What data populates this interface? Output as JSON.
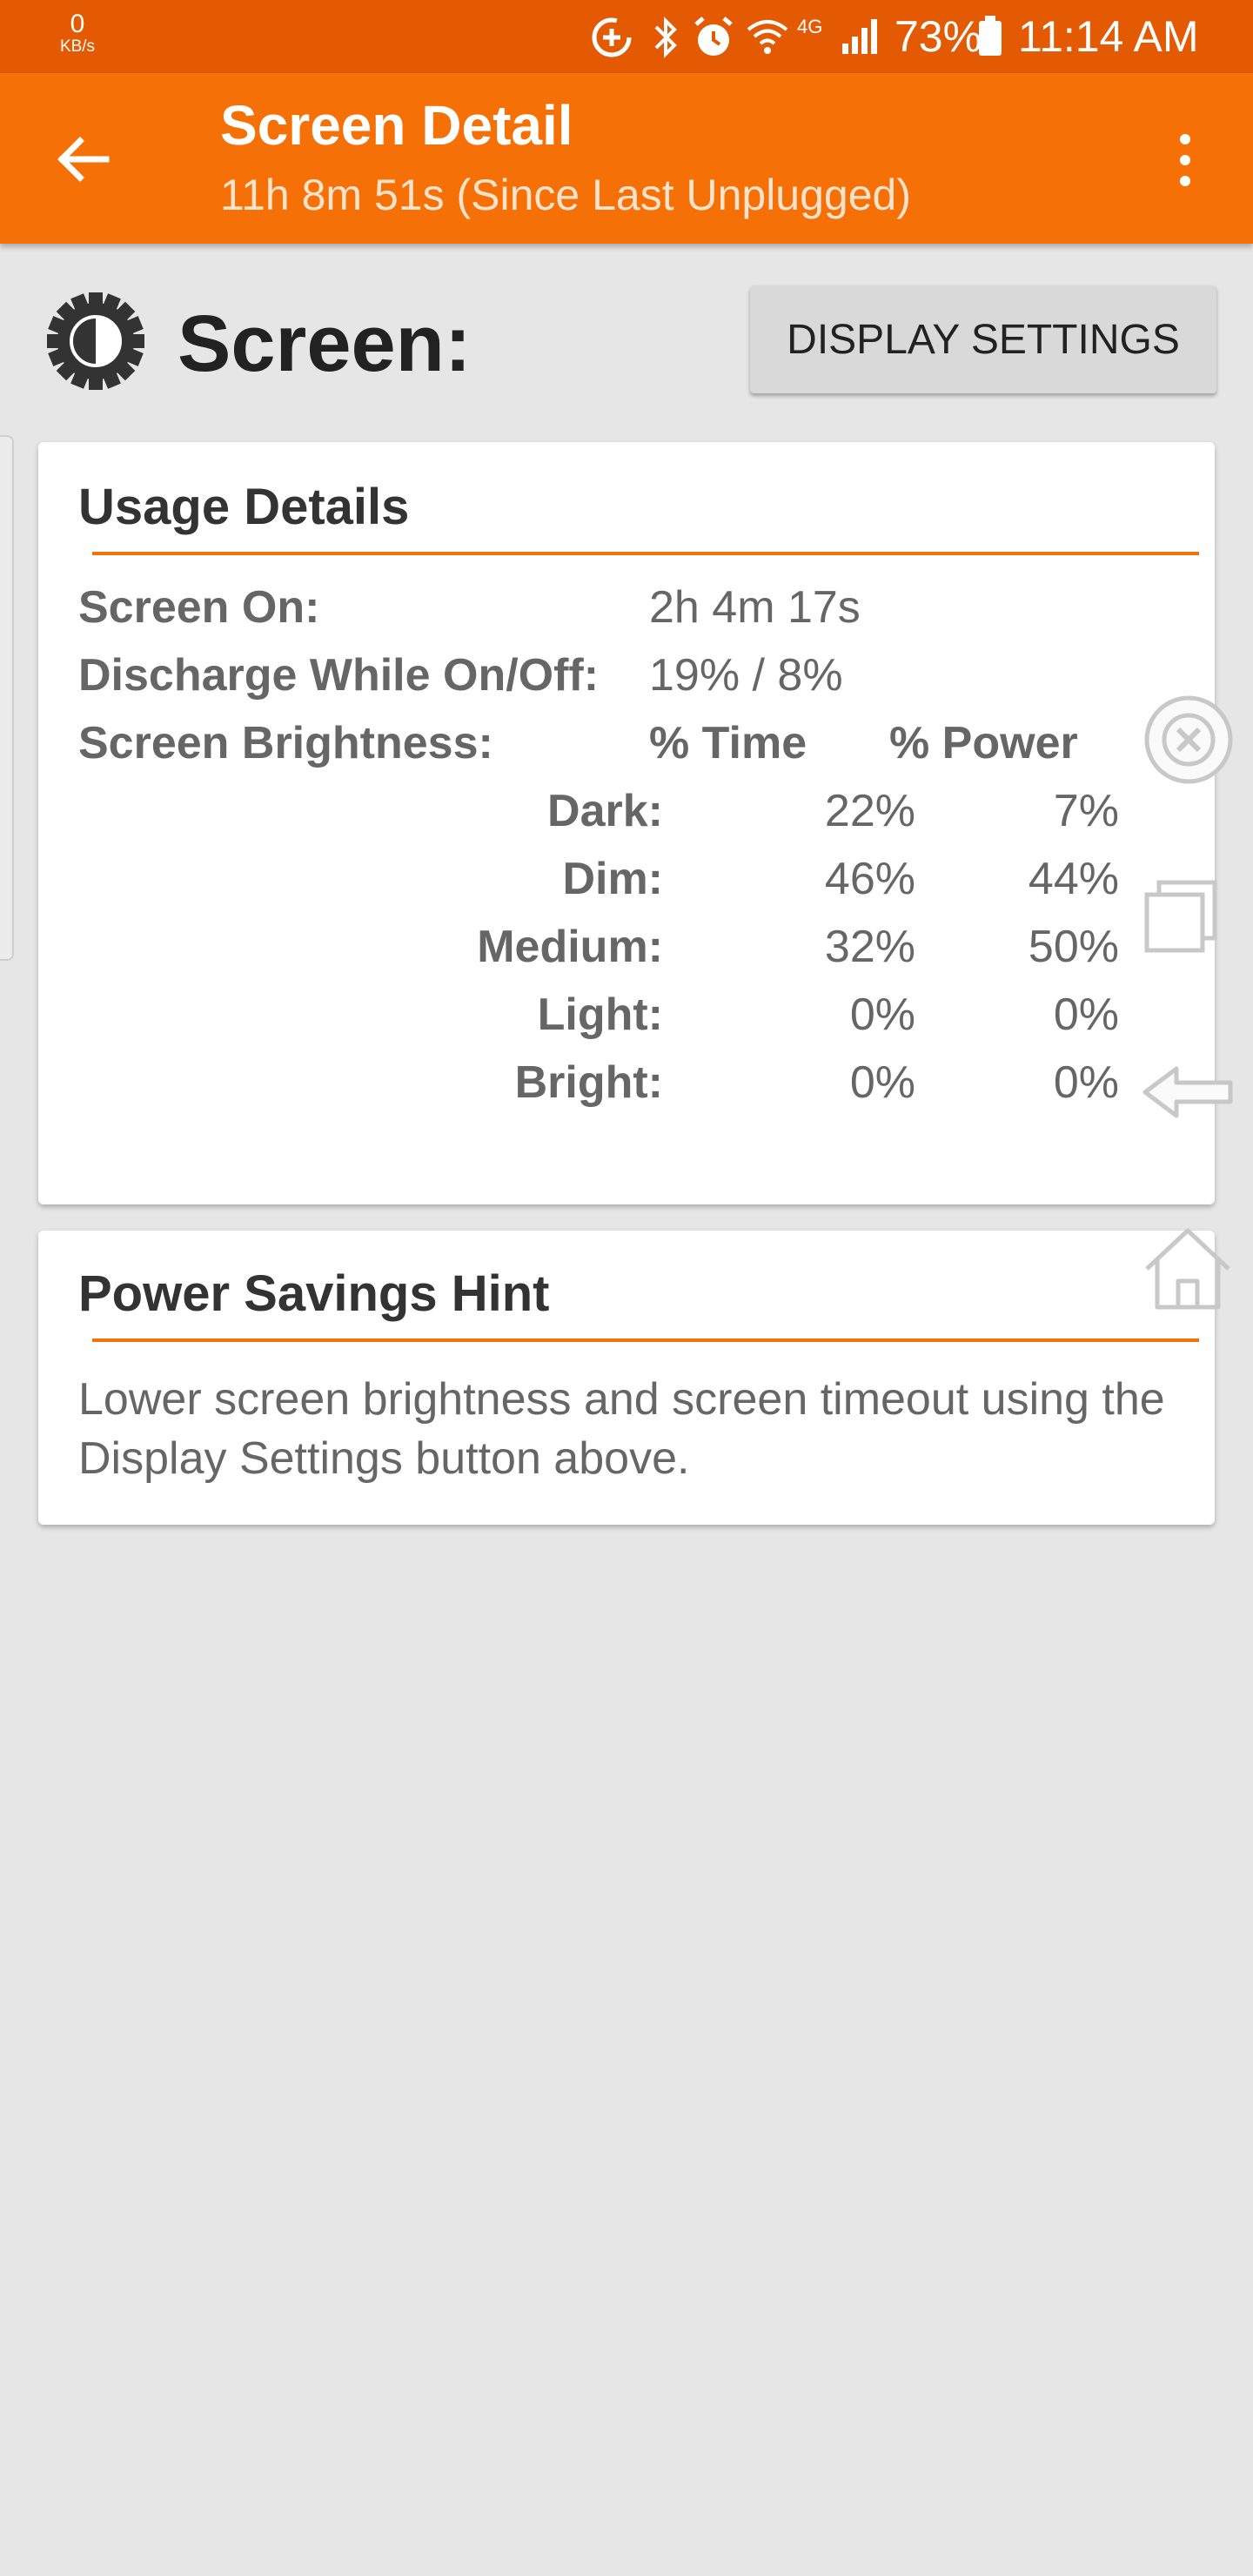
{
  "status_bar": {
    "net_speed_value": "0",
    "net_speed_unit": "KB/s",
    "network_type": "4G",
    "battery_percent": "73%",
    "time": "11:14 AM"
  },
  "app_bar": {
    "title": "Screen Detail",
    "subtitle": "11h 8m 51s (Since Last Unplugged)"
  },
  "header": {
    "heading": "Screen:",
    "display_settings_label": "DISPLAY SETTINGS"
  },
  "usage_details": {
    "title": "Usage Details",
    "screen_on_label": "Screen On:",
    "screen_on_value": "2h 4m 17s",
    "discharge_label": "Discharge While On/Off:",
    "discharge_value": "19% / 8%",
    "brightness_label": "Screen Brightness:",
    "col_time": "% Time",
    "col_power": "% Power",
    "rows": [
      {
        "label": "Dark:",
        "time": "22%",
        "power": "7%"
      },
      {
        "label": "Dim:",
        "time": "46%",
        "power": "44%"
      },
      {
        "label": "Medium:",
        "time": "32%",
        "power": "50%"
      },
      {
        "label": "Light:",
        "time": "0%",
        "power": "0%"
      },
      {
        "label": "Bright:",
        "time": "0%",
        "power": "0%"
      }
    ]
  },
  "power_hint": {
    "title": "Power Savings Hint",
    "text": "Lower screen brightness and screen timeout using the Display Settings button above."
  },
  "colors": {
    "status_bar": "#e45a03",
    "app_bar": "#f57107",
    "accent": "#f57107",
    "background": "#e6e6e6"
  },
  "icons": [
    "sync-icon",
    "bluetooth-icon",
    "alarm-icon",
    "wifi-icon",
    "signal-icon",
    "battery-icon",
    "back-arrow-icon",
    "overflow-menu-icon",
    "brightness-gear-icon",
    "close-circle-icon",
    "recent-apps-icon",
    "back-nav-icon",
    "home-icon"
  ]
}
